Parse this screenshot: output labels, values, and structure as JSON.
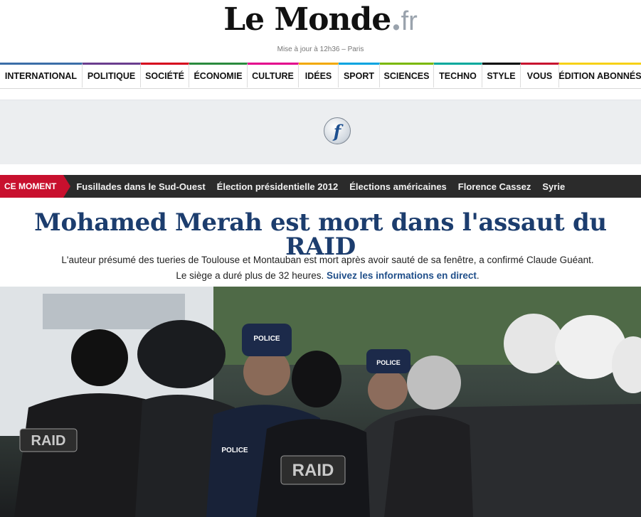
{
  "masthead": {
    "logo_text": "Le Monde",
    "logo_dot": ".",
    "logo_tld": "fr",
    "updated": "Mise à jour à 12h36 – Paris"
  },
  "nav": [
    {
      "label": "INTERNATIONAL",
      "color": "#3b6ea8"
    },
    {
      "label": "POLITIQUE",
      "color": "#6a3d8e"
    },
    {
      "label": "SOCIÉTÉ",
      "color": "#d6001c"
    },
    {
      "label": "ÉCONOMIE",
      "color": "#2b8a3e"
    },
    {
      "label": "CULTURE",
      "color": "#e3008c"
    },
    {
      "label": "IDÉES",
      "color": "#f2a900"
    },
    {
      "label": "SPORT",
      "color": "#00a3e0"
    },
    {
      "label": "SCIENCES",
      "color": "#7ab800"
    },
    {
      "label": "TECHNO",
      "color": "#00a99d"
    },
    {
      "label": "STYLE",
      "color": "#000000"
    },
    {
      "label": "VOUS",
      "color": "#c8102e"
    },
    {
      "label": "ÉDITION ABONNÉS",
      "color": "#f7d117"
    }
  ],
  "ad": {
    "icon": "flash-plugin-icon",
    "glyph": "f"
  },
  "trending": {
    "label": "CE MOMENT",
    "links": [
      "Fusillades dans le Sud-Ouest",
      "Élection présidentielle 2012",
      "Élections américaines",
      "Florence Cassez",
      "Syrie"
    ]
  },
  "article": {
    "headline": "Mohamed Merah est mort dans l'assaut du RAID",
    "lead_line1": "L'auteur présumé des tueries de Toulouse et Montauban est mort après avoir sauté de sa fenêtre, a confirmé Claude Guéant.",
    "lead_line2": "Le siège a duré plus de 32 heures.",
    "lead_link": "Suivez les informations en direct",
    "lead_end": ".",
    "photo_text": {
      "raid1": "RAID",
      "raid2": "RAID",
      "police1": "POLICE",
      "police2": "POLICE",
      "police3": "POLICE"
    }
  }
}
